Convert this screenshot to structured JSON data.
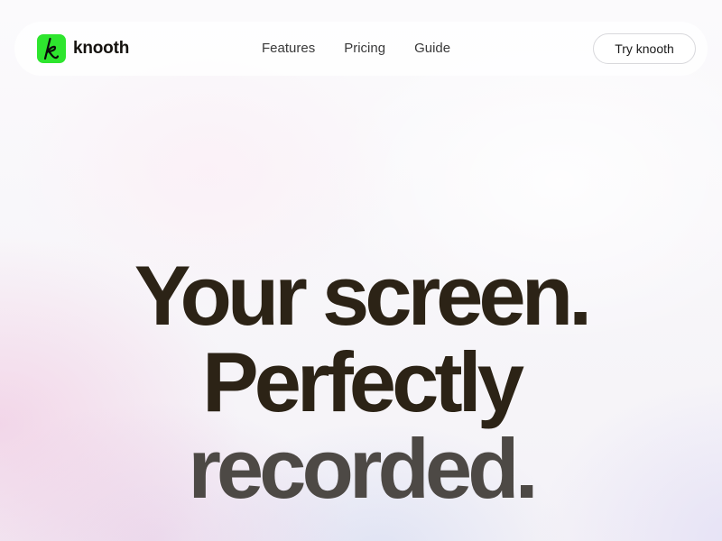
{
  "brand": {
    "name": "knooth",
    "logo_icon": "k-logo-icon",
    "logo_color": "#2ee52e"
  },
  "nav": {
    "links": [
      {
        "label": "Features"
      },
      {
        "label": "Pricing"
      },
      {
        "label": "Guide"
      }
    ],
    "cta_label": "Try knooth"
  },
  "hero": {
    "line1": "Your screen.",
    "line2": "Perfectly",
    "line3": "recorded."
  },
  "colors": {
    "heading": "#2c2316",
    "heading_muted": "#4d4945",
    "accent": "#2ee52e"
  }
}
